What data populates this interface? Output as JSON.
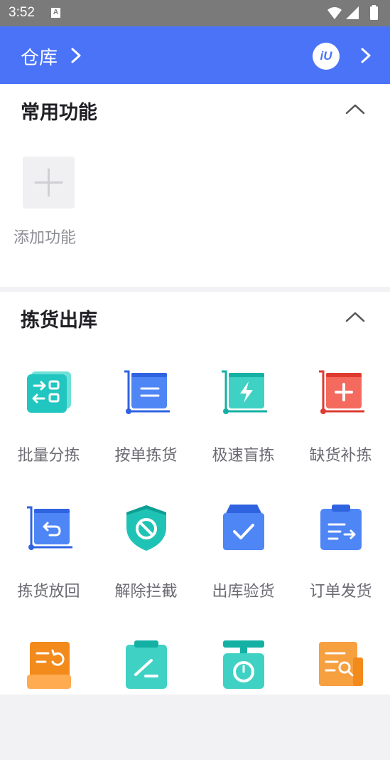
{
  "status_bar": {
    "time": "3:52",
    "notification_glyph": "A",
    "icons": [
      "wifi-icon",
      "signal-icon",
      "battery-icon"
    ]
  },
  "navbar": {
    "title": "仓库",
    "logo_text": "iU",
    "background": "#4a73f7"
  },
  "sections": [
    {
      "title": "常用功能",
      "items": [
        {
          "label": "添加功能",
          "icon": "plus-icon"
        }
      ]
    },
    {
      "title": "拣货出库",
      "items": [
        {
          "label": "批量分拣",
          "icon": "batch-sort-icon",
          "color": "#22c6c0"
        },
        {
          "label": "按单拣货",
          "icon": "order-pick-icon",
          "color": "#3b76f0"
        },
        {
          "label": "极速盲拣",
          "icon": "fast-blind-pick-icon",
          "color": "#1fc3b6"
        },
        {
          "label": "缺货补拣",
          "icon": "restock-pick-icon",
          "color": "#f0554a"
        },
        {
          "label": "拣货放回",
          "icon": "pick-return-icon",
          "color": "#3b76f0"
        },
        {
          "label": "解除拦截",
          "icon": "release-intercept-icon",
          "color": "#1fc3b6"
        },
        {
          "label": "出库验货",
          "icon": "outbound-inspect-icon",
          "color": "#3b76f0"
        },
        {
          "label": "订单发货",
          "icon": "order-ship-icon",
          "color": "#3b76f0"
        },
        {
          "label": "",
          "icon": "return-list-icon",
          "color": "#f28a1c"
        },
        {
          "label": "",
          "icon": "clipboard-sign-icon",
          "color": "#1fc3b6"
        },
        {
          "label": "",
          "icon": "scale-icon",
          "color": "#1fc3b6"
        },
        {
          "label": "",
          "icon": "search-list-icon",
          "color": "#f28a1c"
        }
      ]
    }
  ]
}
